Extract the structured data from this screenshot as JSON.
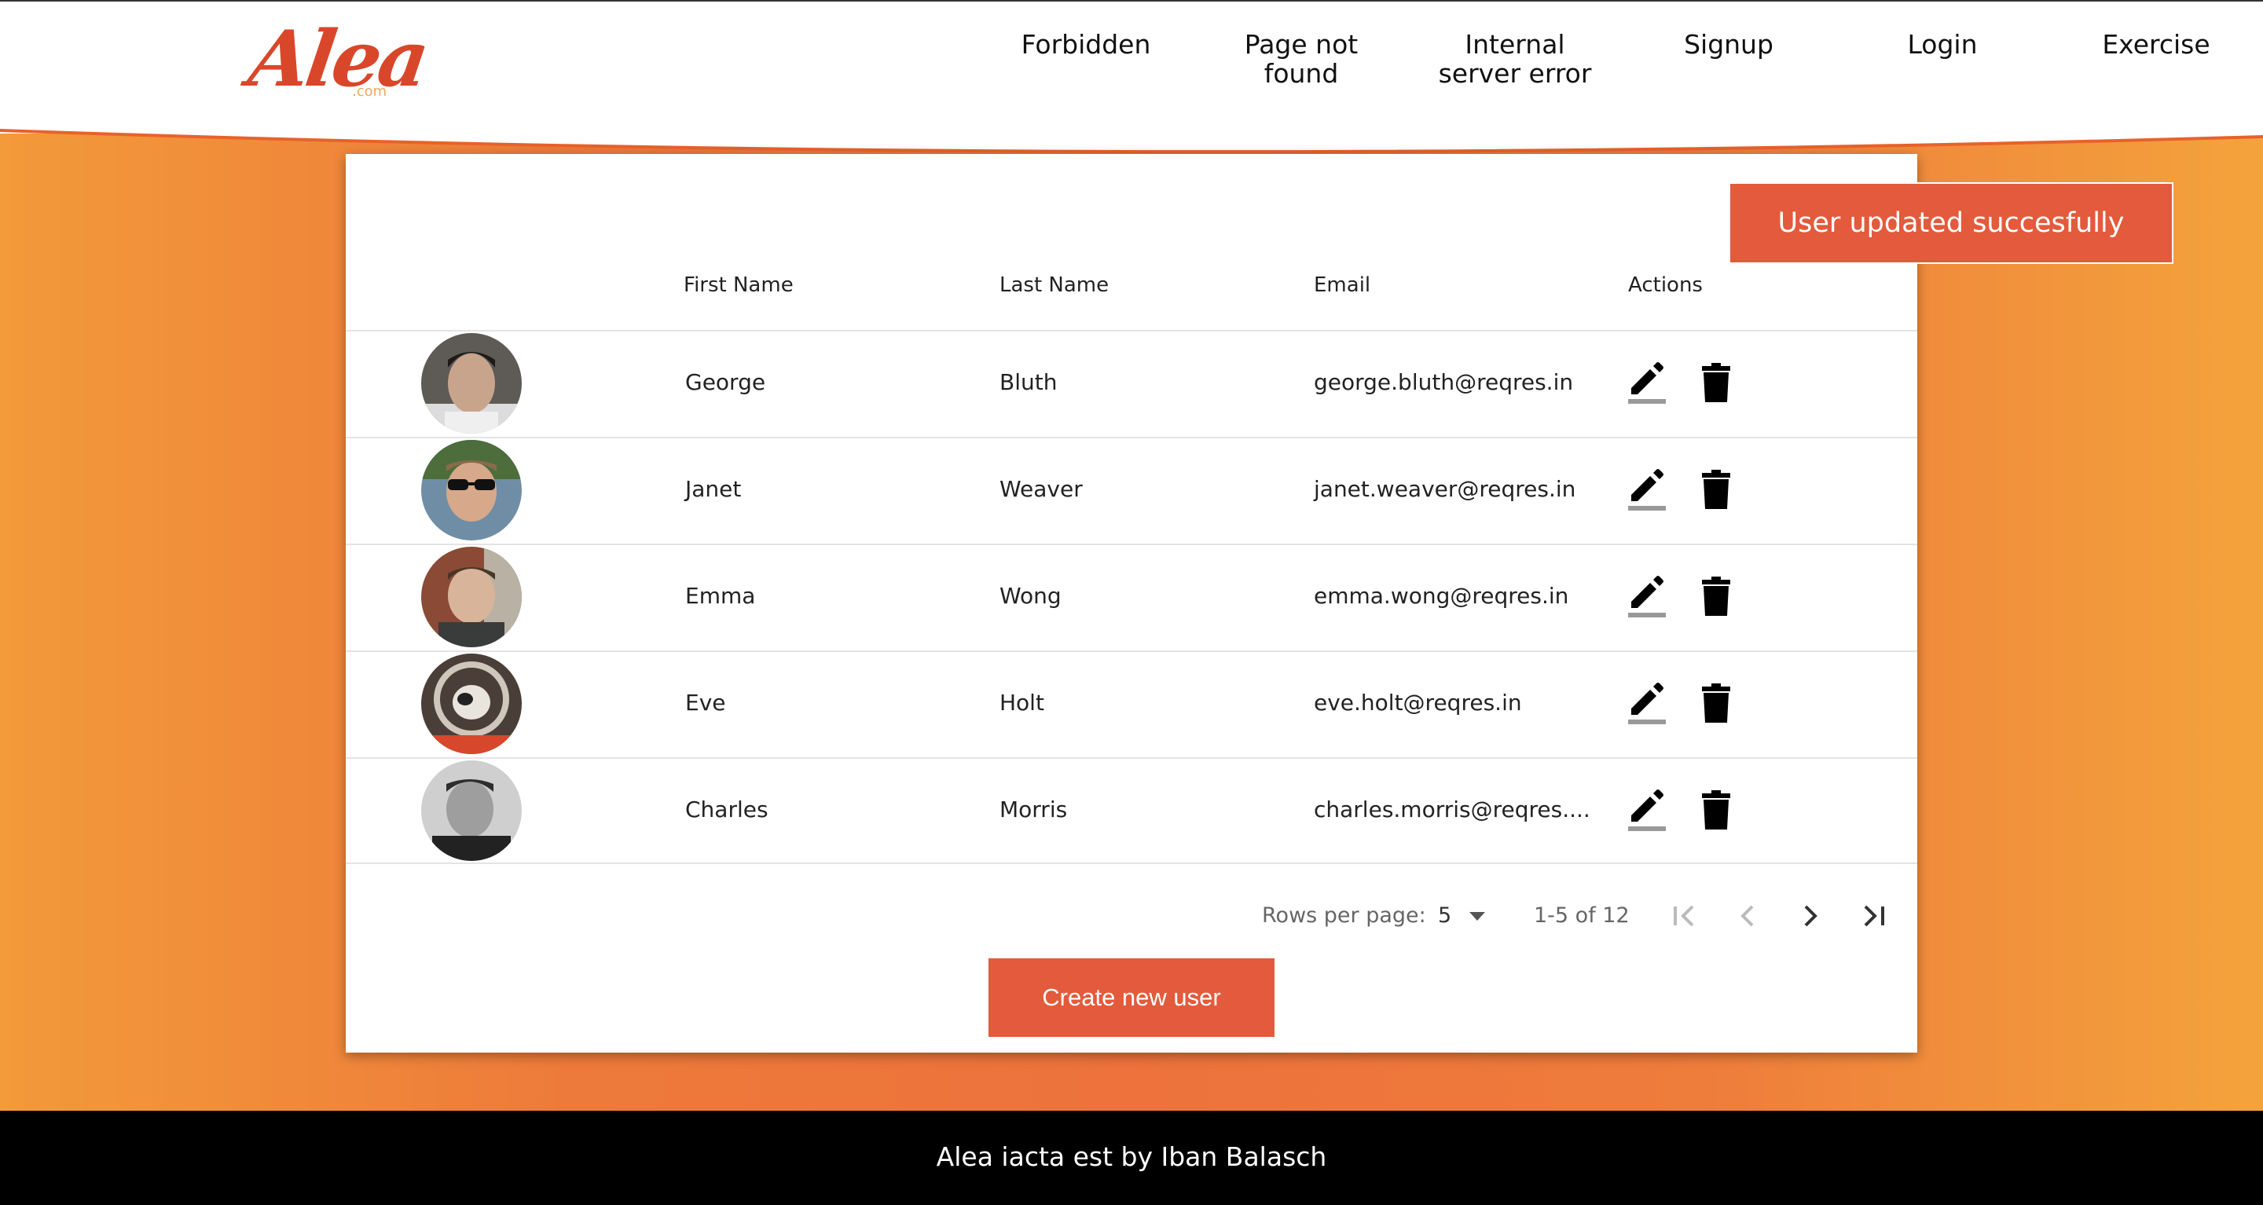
{
  "logo": {
    "text": "Alea",
    "sub": ".com"
  },
  "nav": {
    "forbidden": "Forbidden",
    "page_not_found": "Page not\nfound",
    "internal_error": "Internal\nserver error",
    "signup": "Signup",
    "login": "Login",
    "exercise": "Exercise"
  },
  "toast": {
    "message": "User updated succesfully"
  },
  "table": {
    "headers": {
      "first_name": "First Name",
      "last_name": "Last Name",
      "email": "Email",
      "actions": "Actions"
    },
    "rows": [
      {
        "first_name": "George",
        "last_name": "Bluth",
        "email": "george.bluth@reqres.in"
      },
      {
        "first_name": "Janet",
        "last_name": "Weaver",
        "email": "janet.weaver@reqres.in"
      },
      {
        "first_name": "Emma",
        "last_name": "Wong",
        "email": "emma.wong@reqres.in"
      },
      {
        "first_name": "Eve",
        "last_name": "Holt",
        "email": "eve.holt@reqres.in"
      },
      {
        "first_name": "Charles",
        "last_name": "Morris",
        "email": "charles.morris@reqres...."
      }
    ],
    "action_icons": [
      "edit-icon",
      "delete-icon"
    ]
  },
  "pagination": {
    "rows_per_page_label": "Rows per page:",
    "rows_per_page_value": "5",
    "range": "1-5 of 12"
  },
  "create_button": "Create new user",
  "footer": "Alea iacta est by Iban Balasch",
  "colors": {
    "accent": "#e35a3c",
    "orange_start": "#f39a3a",
    "orange_mid": "#ed723c",
    "footer_bg": "#000000"
  }
}
